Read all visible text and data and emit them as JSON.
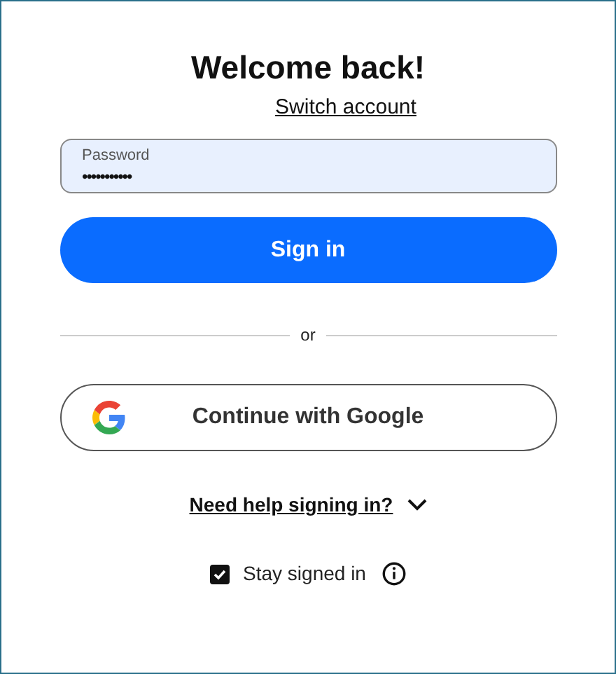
{
  "title": "Welcome back!",
  "switch_account": "Switch account",
  "password_field": {
    "label": "Password",
    "value": "•••••••••••"
  },
  "sign_in_button": "Sign in",
  "divider_text": "or",
  "google_button": "Continue with Google",
  "help_link": {
    "label": "Need help signing in?",
    "expanded": false
  },
  "stay_signed_in": {
    "label": "Stay signed in",
    "checked": true
  }
}
